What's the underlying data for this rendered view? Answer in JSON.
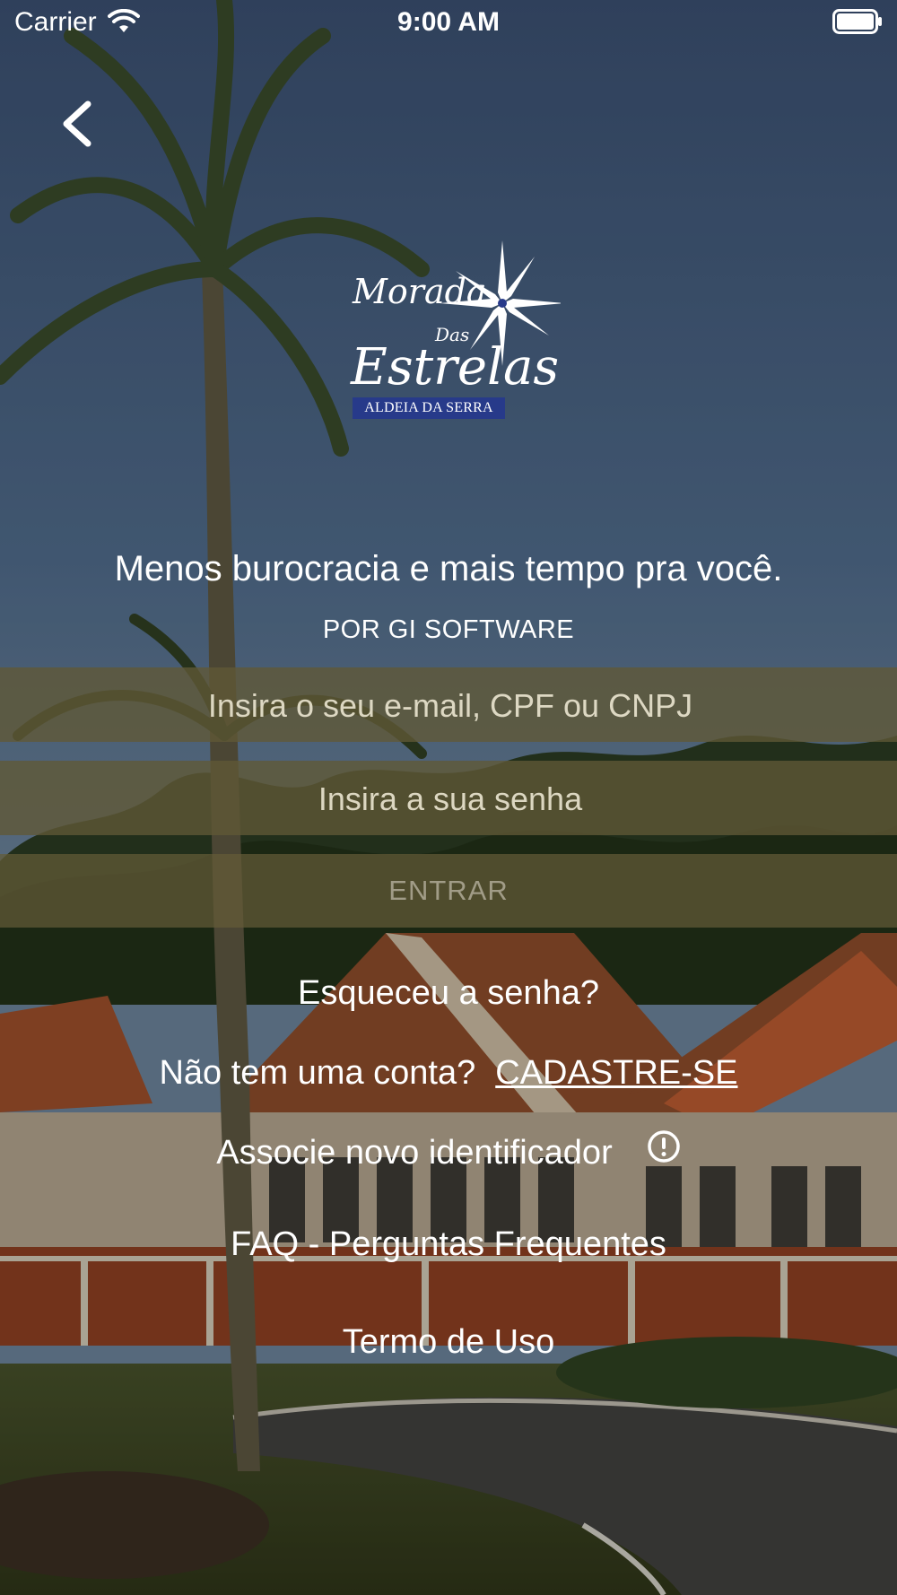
{
  "status_bar": {
    "carrier": "Carrier",
    "time": "9:00 AM"
  },
  "nav": {
    "back_icon": "chevron-left-icon"
  },
  "logo": {
    "line1": "Morada",
    "line2": "Das",
    "line3": "Estrelas",
    "band": "ALDEIA DA SERRA"
  },
  "tagline": "Menos burocracia e mais tempo pra você.",
  "byline": "POR GI SOFTWARE",
  "form": {
    "email_placeholder": "Insira o seu e-mail, CPF ou CNPJ",
    "email_value": "",
    "password_placeholder": "Insira a sua senha",
    "password_value": "",
    "submit_label": "ENTRAR"
  },
  "links": {
    "forgot_password": "Esqueceu a senha?",
    "no_account": "Não tem uma conta?",
    "signup": "CADASTRE-SE",
    "associate": "Associe novo identificador",
    "associate_icon": "info-icon",
    "faq": "FAQ - Perguntas Frequentes",
    "terms": "Termo de Uso"
  },
  "colors": {
    "field_overlay": "#605836",
    "logo_band": "#273a8a",
    "sky": "#2f4b72"
  }
}
